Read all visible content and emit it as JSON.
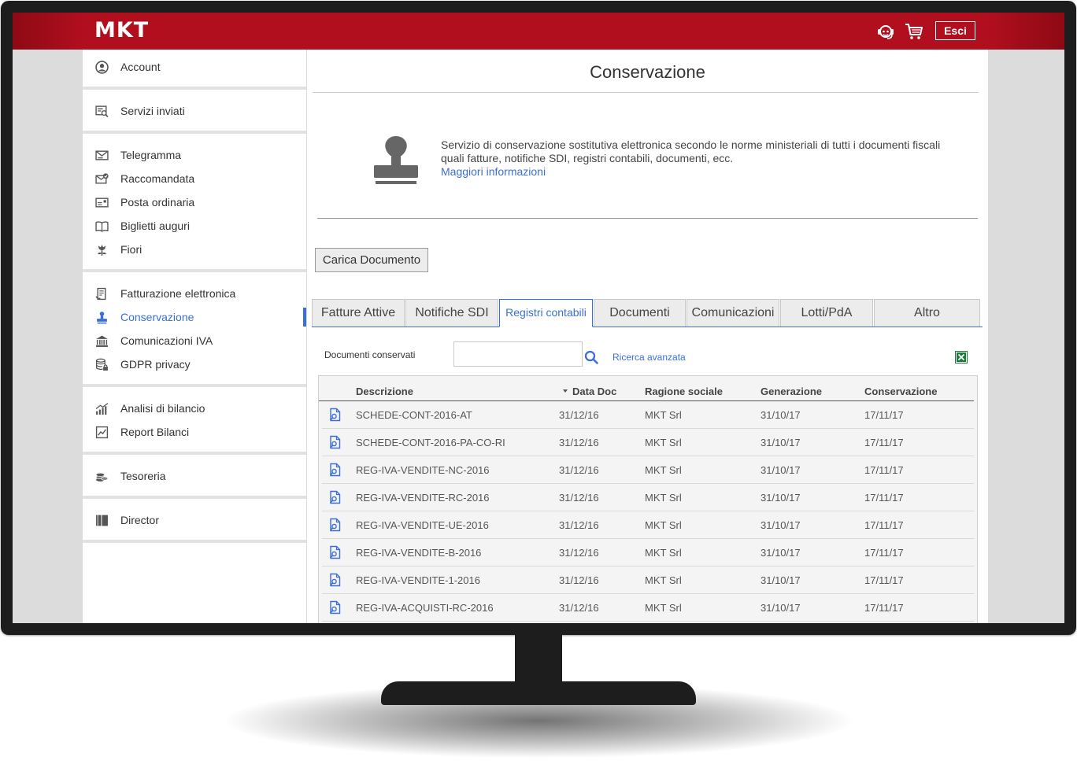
{
  "app": {
    "logo": "MKT",
    "logout_label": "Esci"
  },
  "sidebar": {
    "groups": [
      [
        {
          "label": "Account",
          "icon": "user-circle-icon"
        }
      ],
      [
        {
          "label": "Servizi inviati",
          "icon": "sent-services-icon"
        }
      ],
      [
        {
          "label": "Telegramma",
          "icon": "telegram-mail-icon"
        },
        {
          "label": "Raccomandata",
          "icon": "registered-mail-icon"
        },
        {
          "label": "Posta ordinaria",
          "icon": "ordinary-mail-icon"
        },
        {
          "label": "Biglietti auguri",
          "icon": "greeting-card-icon"
        },
        {
          "label": "Fiori",
          "icon": "flower-icon"
        }
      ],
      [
        {
          "label": "Fatturazione elettronica",
          "icon": "invoice-icon"
        },
        {
          "label": "Conservazione",
          "icon": "stamp-icon",
          "active": true
        },
        {
          "label": "Comunicazioni IVA",
          "icon": "bank-icon"
        },
        {
          "label": "GDPR privacy",
          "icon": "database-lock-icon"
        }
      ],
      [
        {
          "label": "Analisi di bilancio",
          "icon": "bar-chart-icon"
        },
        {
          "label": "Report Bilanci",
          "icon": "report-chart-icon"
        }
      ],
      [
        {
          "label": "Tesoreria",
          "icon": "coins-icon"
        }
      ],
      [
        {
          "label": "Director",
          "icon": "book-icon"
        }
      ]
    ]
  },
  "main": {
    "title": "Conservazione",
    "info": {
      "text": "Servizio di conservazione sostitutiva elettronica secondo le norme ministeriali di tutti i documenti fiscali quali fatture, notifiche SDI, registri contabili, documenti, ecc.",
      "link": "Maggiori informazioni"
    },
    "upload_button": "Carica Documento",
    "tabs": [
      {
        "label": "Fatture Attive"
      },
      {
        "label": "Notifiche SDI"
      },
      {
        "label": "Registri contabili",
        "active": true
      },
      {
        "label": "Documenti"
      },
      {
        "label": "Comunicazioni"
      },
      {
        "label": "Lotti/PdA"
      },
      {
        "label": "Altro"
      }
    ],
    "search": {
      "label": "Documenti conservati",
      "value": "",
      "placeholder": "",
      "advanced_link": "Ricerca avanzata"
    },
    "table": {
      "columns": [
        "Descrizione",
        "Data Doc",
        "Ragione sociale",
        "Generazione",
        "Conservazione"
      ],
      "rows": [
        [
          "SCHEDE-CONT-2016-AT",
          "31/12/16",
          "MKT Srl",
          "31/10/17",
          "17/11/17"
        ],
        [
          "SCHEDE-CONT-2016-PA-CO-RI",
          "31/12/16",
          "MKT Srl",
          "31/10/17",
          "17/11/17"
        ],
        [
          "REG-IVA-VENDITE-NC-2016",
          "31/12/16",
          "MKT Srl",
          "31/10/17",
          "17/11/17"
        ],
        [
          "REG-IVA-VENDITE-RC-2016",
          "31/12/16",
          "MKT Srl",
          "31/10/17",
          "17/11/17"
        ],
        [
          "REG-IVA-VENDITE-UE-2016",
          "31/12/16",
          "MKT Srl",
          "31/10/17",
          "17/11/17"
        ],
        [
          "REG-IVA-VENDITE-B-2016",
          "31/12/16",
          "MKT Srl",
          "31/10/17",
          "17/11/17"
        ],
        [
          "REG-IVA-VENDITE-1-2016",
          "31/12/16",
          "MKT Srl",
          "31/10/17",
          "17/11/17"
        ],
        [
          "REG-IVA-ACQUISTI-RC-2016",
          "31/12/16",
          "MKT Srl",
          "31/10/17",
          "17/11/17"
        ]
      ]
    }
  },
  "colors": {
    "brand_red": "#b10e1e",
    "accent_blue": "#3b6fd8",
    "excel_green": "#1e7a3c"
  }
}
